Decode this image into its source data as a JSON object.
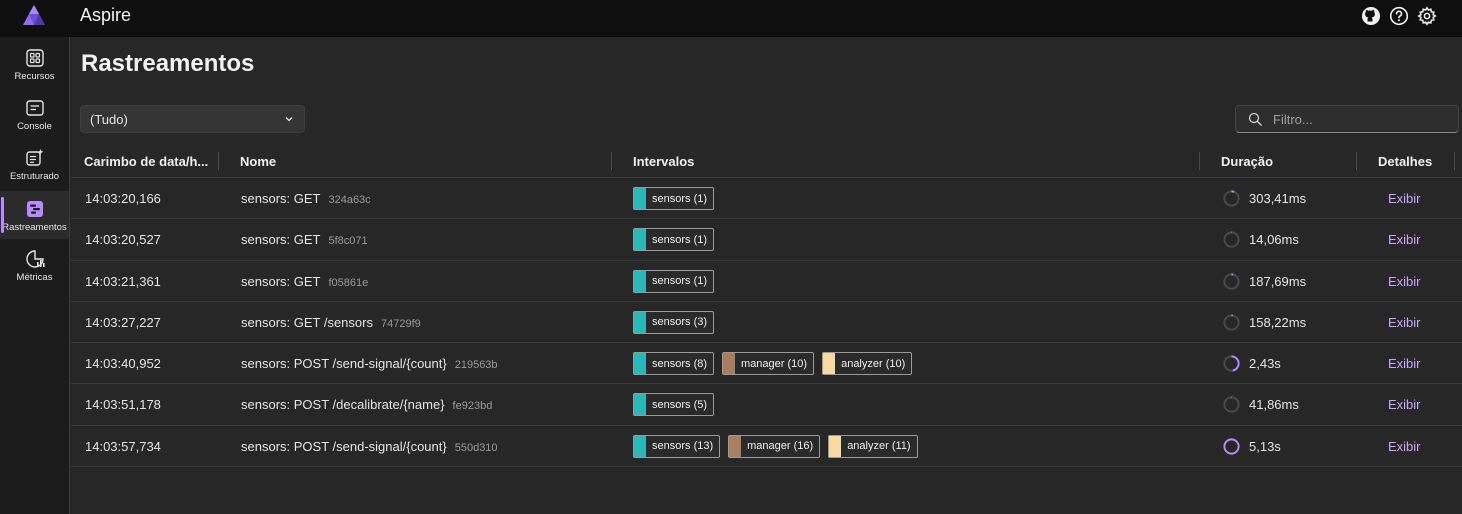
{
  "app": {
    "title": "Aspire"
  },
  "top_icons": [
    "github-icon",
    "help-icon",
    "settings-icon"
  ],
  "sidebar": {
    "items": [
      {
        "label": "Recursos",
        "icon": "grid-icon",
        "active": false
      },
      {
        "label": "Console",
        "icon": "console-icon",
        "active": false
      },
      {
        "label": "Estruturado",
        "icon": "structured-icon",
        "active": false
      },
      {
        "label": "Rastreamentos",
        "icon": "traces-icon",
        "active": true
      },
      {
        "label": "Métricas",
        "icon": "metrics-icon",
        "active": false
      }
    ]
  },
  "page": {
    "title": "Rastreamentos"
  },
  "filter": {
    "selected": "(Tudo)"
  },
  "search": {
    "placeholder": "Filtro..."
  },
  "table": {
    "headers": {
      "timestamp": "Carimbo de data/h...",
      "name": "Nome",
      "spans": "Intervalos",
      "duration": "Duração",
      "details": "Detalhes"
    },
    "colors": {
      "sensors": "#2bb8b8",
      "manager": "#a77e5f",
      "analyzer": "#f7dba0",
      "duration_ring": "#b58bff"
    },
    "rows": [
      {
        "timestamp": "14:03:20,166",
        "name": "sensors: GET",
        "trace_id": "324a63c",
        "spans": [
          {
            "label": "sensors (1)",
            "kind": "sensors"
          }
        ],
        "duration": "303,41ms",
        "fill": 0.06,
        "action": "Exibir"
      },
      {
        "timestamp": "14:03:20,527",
        "name": "sensors: GET",
        "trace_id": "5f8c071",
        "spans": [
          {
            "label": "sensors (1)",
            "kind": "sensors"
          }
        ],
        "duration": "14,06ms",
        "fill": 0.01,
        "action": "Exibir"
      },
      {
        "timestamp": "14:03:21,361",
        "name": "sensors: GET",
        "trace_id": "f05861e",
        "spans": [
          {
            "label": "sensors (1)",
            "kind": "sensors"
          }
        ],
        "duration": "187,69ms",
        "fill": 0.04,
        "action": "Exibir"
      },
      {
        "timestamp": "14:03:27,227",
        "name": "sensors: GET /sensors",
        "trace_id": "74729f9",
        "spans": [
          {
            "label": "sensors (3)",
            "kind": "sensors"
          }
        ],
        "duration": "158,22ms",
        "fill": 0.03,
        "action": "Exibir"
      },
      {
        "timestamp": "14:03:40,952",
        "name": "sensors: POST /send-signal/{count}",
        "trace_id": "219563b",
        "spans": [
          {
            "label": "sensors (8)",
            "kind": "sensors"
          },
          {
            "label": "manager (10)",
            "kind": "manager"
          },
          {
            "label": "analyzer (10)",
            "kind": "analyzer"
          }
        ],
        "duration": "2,43s",
        "fill": 0.47,
        "action": "Exibir"
      },
      {
        "timestamp": "14:03:51,178",
        "name": "sensors: POST /decalibrate/{name}",
        "trace_id": "fe923bd",
        "spans": [
          {
            "label": "sensors (5)",
            "kind": "sensors"
          }
        ],
        "duration": "41,86ms",
        "fill": 0.01,
        "action": "Exibir"
      },
      {
        "timestamp": "14:03:57,734",
        "name": "sensors: POST /send-signal/{count}",
        "trace_id": "550d310",
        "spans": [
          {
            "label": "sensors (13)",
            "kind": "sensors"
          },
          {
            "label": "manager (16)",
            "kind": "manager"
          },
          {
            "label": "analyzer (11)",
            "kind": "analyzer"
          }
        ],
        "duration": "5,13s",
        "fill": 1.0,
        "action": "Exibir"
      }
    ]
  }
}
